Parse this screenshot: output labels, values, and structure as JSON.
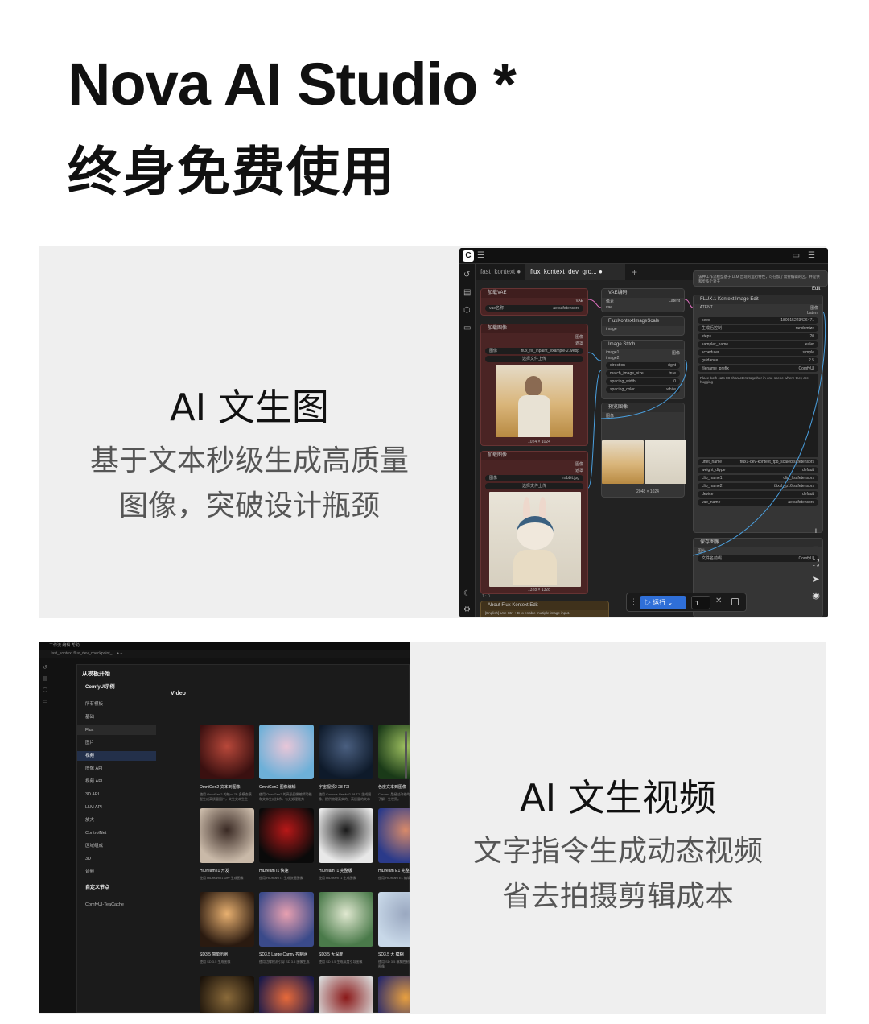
{
  "hero": {
    "title": "Nova AI Studio *",
    "subtitle": "终身免费使用"
  },
  "feature1": {
    "title": "AI 文生图",
    "desc_line1": "基于文本秒级生成高质量",
    "desc_line2": "图像，突破设计瓶颈"
  },
  "feature2": {
    "title": "AI 文生视频",
    "desc_line1": "文字指令生成动态视频",
    "desc_line2": "省去拍摄剪辑成本"
  },
  "editor": {
    "tabs": [
      "fast_kontext",
      "flux_kontext_dev_gro..."
    ],
    "edit_badge": "Edit",
    "notice": "该种工作流模型基于 LLM 出现的运行特性，可在加了需要编辑的区，并提供和步多个对于",
    "nodes": {
      "load_vae": {
        "title": "加载VAE",
        "port": "VAE",
        "field_label": "vae名称",
        "field_value": "ae.safetensors"
      },
      "vae_encode": {
        "title": "VAE编码",
        "in1": "像素",
        "in2": "vae",
        "out": "Latent"
      },
      "flux_scale": {
        "title": "FluxKontextImageScale",
        "in": "image"
      },
      "image_stitch": {
        "title": "Image Stitch",
        "in1": "image1",
        "in2": "image2",
        "out": "图像",
        "rows": [
          {
            "k": "direction",
            "v": "right"
          },
          {
            "k": "match_image_size",
            "v": "true"
          },
          {
            "k": "spacing_width",
            "v": "0"
          },
          {
            "k": "spacing_color",
            "v": "white"
          }
        ]
      },
      "load_image_1": {
        "title": "加载图像",
        "out1": "图像",
        "out2": "遮罩",
        "file_label": "图像",
        "file": "flux_fill_inpaint_example-2.webp",
        "upload": "选择文件上传",
        "size": "1024 × 1024"
      },
      "load_image_2": {
        "title": "加载图像",
        "out1": "图像",
        "out2": "遮罩",
        "file_label": "图像",
        "file": "rabbit.jpg",
        "upload": "选择文件上传",
        "size": "1328 × 1328"
      },
      "preview": {
        "title": "预览图像",
        "in": "图像",
        "size": "2048 × 1024"
      },
      "flux_edit": {
        "title": "FLUX.1 Kontext Image Edit",
        "in": "LATENT",
        "out1": "图像",
        "out2": "Latent",
        "rows": [
          {
            "k": "seed",
            "v": "180915223426471"
          },
          {
            "k": "生成后控制",
            "v": "randomize"
          },
          {
            "k": "steps",
            "v": "20"
          },
          {
            "k": "sampler_name",
            "v": "euler"
          },
          {
            "k": "scheduler",
            "v": "simple"
          },
          {
            "k": "guidance",
            "v": "2.5"
          },
          {
            "k": "filename_prefix",
            "v": "ComfyUI"
          }
        ],
        "prompt": "Place both cats 88 characters together in one scene where they are hugging",
        "rows2": [
          {
            "k": "unet_name",
            "v": "flux1-dev-kontext_fp8_scaled.safetensors"
          },
          {
            "k": "weight_dtype",
            "v": "default"
          },
          {
            "k": "clip_name1",
            "v": "clip_l.safetensors"
          },
          {
            "k": "clip_name2",
            "v": "t5xxl_fp16.safetensors"
          },
          {
            "k": "device",
            "v": "default"
          },
          {
            "k": "vae_name",
            "v": "ae.safetensors"
          }
        ]
      },
      "save": {
        "title": "保存图像",
        "in": "图片",
        "field_label": "文件名前缀",
        "field_value": "ComfyUI"
      },
      "about": {
        "title": "About Flux Kontext Edit",
        "text": "[English] Use Ctrl + B to enable multiple image input."
      }
    },
    "run": {
      "label": "运行",
      "count": "1"
    },
    "status": "1 : 0"
  },
  "templates": {
    "menubar": "工作流    编辑    帮助",
    "tabs": "fast_kontext     flux_dev_checkpoint_...  ●   +",
    "dialog_title": "从模板开始",
    "sidebar": {
      "group1": "ComfyUI示例",
      "items": [
        "所有模板",
        "基础",
        "Flux",
        "图片",
        "视频",
        "图像 API",
        "视频 API",
        "3D API",
        "LLM API",
        "放大",
        "ControlNet",
        "区域组成",
        "3D",
        "音频"
      ],
      "group2": "自定义节点",
      "items2": [
        "ComfyUI-TeaCache"
      ]
    },
    "section": "Video",
    "tiles": [
      {
        "title": "OmniGen2 文本到图像",
        "desc": "使用 OmniGen2 的统一 7B 多模态模型生成高质量图片，文生文本生生",
        "color1": "#3a1010",
        "color2": "#b8483a"
      },
      {
        "title": "OmniGen2 图像编辑",
        "desc": "使用 OmniGen2 的高级图像编辑功能和文本生成技术，有关处理能力",
        "color1": "#6db0d8",
        "color2": "#e8c6d8"
      },
      {
        "title": "宇宙视频2 28 T2I",
        "desc": "使用 Cosmos-Predict2 28 T2I 生成图像，提供物理真实的、高质量的文本",
        "color1": "#0e1a2a",
        "color2": "#4a5f80"
      },
      {
        "title": "色度文本到图像",
        "desc": "Chroma 是经过改修的模型，文件型的 了解一生世界。",
        "color1": "#1a3a18",
        "color2": "#9ec060"
      },
      {
        "title": "HiDream I1 开发",
        "desc": "使用 HiDream I1 Dev 生成图像",
        "color1": "#c9b9a8",
        "color2": "#3a2a24"
      },
      {
        "title": "HiDream I1 快速",
        "desc": "使用 HiDream I1 生成快速图像",
        "color1": "#0a0a0a",
        "color2": "#b81818"
      },
      {
        "title": "HiDream I1 完整版",
        "desc": "使用 HiDream I1 生成图像",
        "color1": "#e8e8e8",
        "color2": "#1a1a1a"
      },
      {
        "title": "HiDream E1 完整版",
        "desc": "使用 HiDream E1 编辑图像",
        "color1": "#2a3a8a",
        "color2": "#d88a6a"
      },
      {
        "title": "SD3.5 简单示例",
        "desc": "使用 SD 3.5 生成图像",
        "color1": "#2a1a10",
        "color2": "#e8b070"
      },
      {
        "title": "SD3.5 Large Canny 控制网",
        "desc": "使用边缘检测引导 SD 3.5 图像生成",
        "color1": "#3a4a8a",
        "color2": "#e8a0b0"
      },
      {
        "title": "SD3.5 大深度",
        "desc": "使用 SD 3.5 生成深度引导图像",
        "color1": "#4a7a4a",
        "color2": "#e0e8d0"
      },
      {
        "title": "SD3.5 大 模糊",
        "desc": "使用 SD 3.5 模糊控制网络生成高质量图像",
        "color1": "#c8d8e8",
        "color2": "#9aa8c0"
      },
      {
        "title": "",
        "desc": "",
        "color1": "#1a120a",
        "color2": "#8a6a3a"
      },
      {
        "title": "",
        "desc": "",
        "color1": "#1a1a4a",
        "color2": "#e86a3a"
      },
      {
        "title": "",
        "desc": "",
        "color1": "#d8d8d8",
        "color2": "#8a1818"
      },
      {
        "title": "",
        "desc": "",
        "color1": "#2a2a6a",
        "color2": "#e8a040"
      }
    ]
  }
}
